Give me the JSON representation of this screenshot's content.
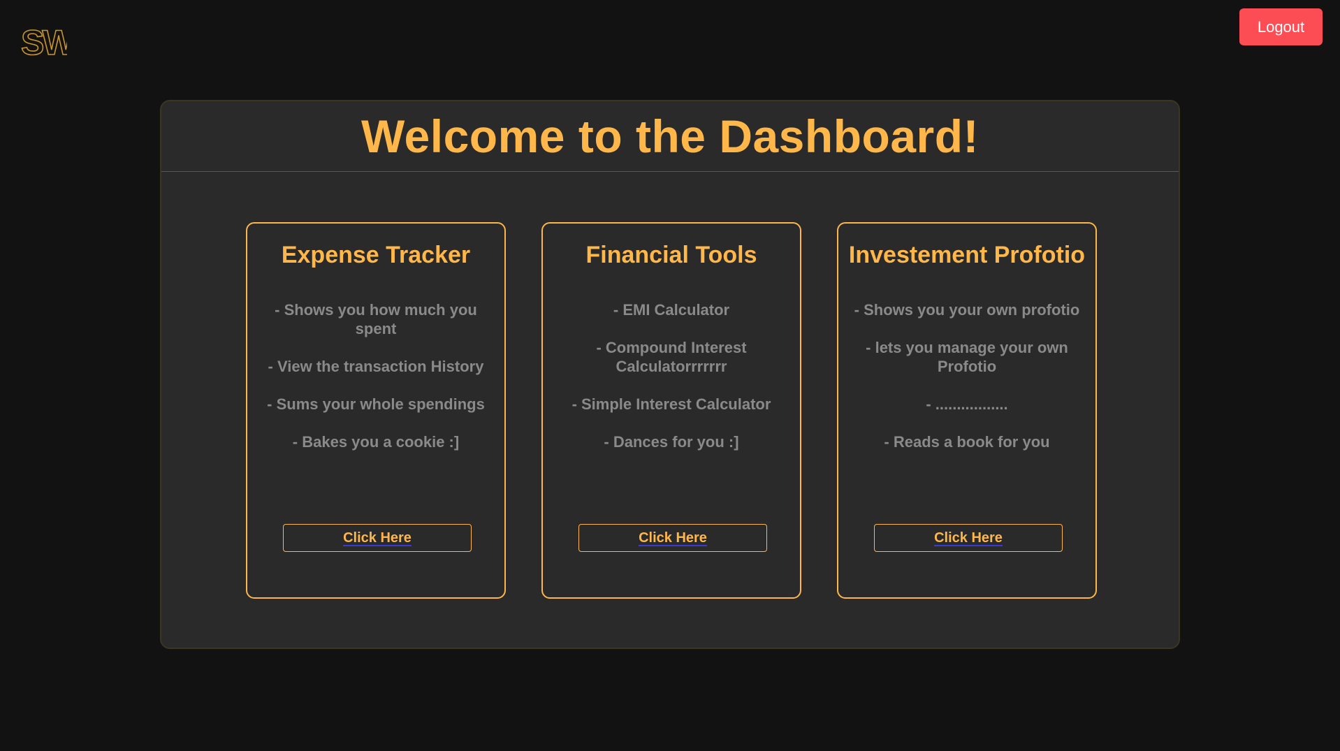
{
  "logo": {
    "text": "SW",
    "color": "#c9962e"
  },
  "header": {
    "logout_label": "Logout"
  },
  "panel": {
    "title": "Welcome to the Dashboard!"
  },
  "cards": [
    {
      "title": "Expense Tracker",
      "features": [
        "- Shows you how much you spent",
        "- View the transaction History",
        "- Sums your whole spendings",
        "- Bakes you a cookie :]"
      ],
      "button_label": "Click Here"
    },
    {
      "title": "Financial Tools",
      "features": [
        "- EMI Calculator",
        "- Compound Interest Calculatorrrrrrr",
        "- Simple Interest Calculator",
        "- Dances for you :]"
      ],
      "button_label": "Click Here"
    },
    {
      "title": "Investement Profotio",
      "features": [
        "- Shows you your own profotio",
        "- lets you manage your own Profotio",
        "- .................",
        "- Reads a book for you"
      ],
      "button_label": "Click Here"
    }
  ],
  "colors": {
    "background": "#121212",
    "panel": "#2a2a2a",
    "accent": "#ffb74a",
    "logout": "#fc4d54",
    "muted_text": "#8a8a8a"
  }
}
